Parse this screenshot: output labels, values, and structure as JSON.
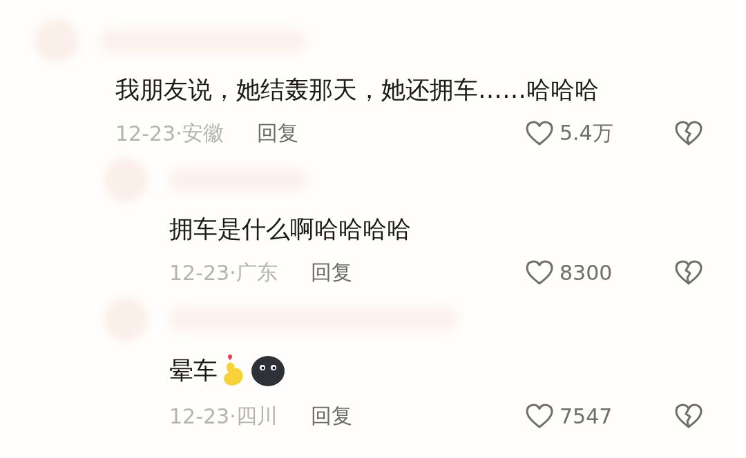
{
  "comments": [
    {
      "text": "我朋友说，她结轰那天，她还拥车……哈哈哈",
      "date": "12-23·",
      "region": "安徽",
      "reply": "回复",
      "likes": "5.4万",
      "emoji": false,
      "children": [
        {
          "text": "拥车是什么啊哈哈哈哈",
          "date": "12-23·",
          "region": "广东",
          "reply": "回复",
          "likes": "8300",
          "emoji": false
        },
        {
          "text": "晕车",
          "date": "12-23·",
          "region": "四川",
          "reply": "回复",
          "likes": "7547",
          "emoji": true
        }
      ]
    }
  ]
}
